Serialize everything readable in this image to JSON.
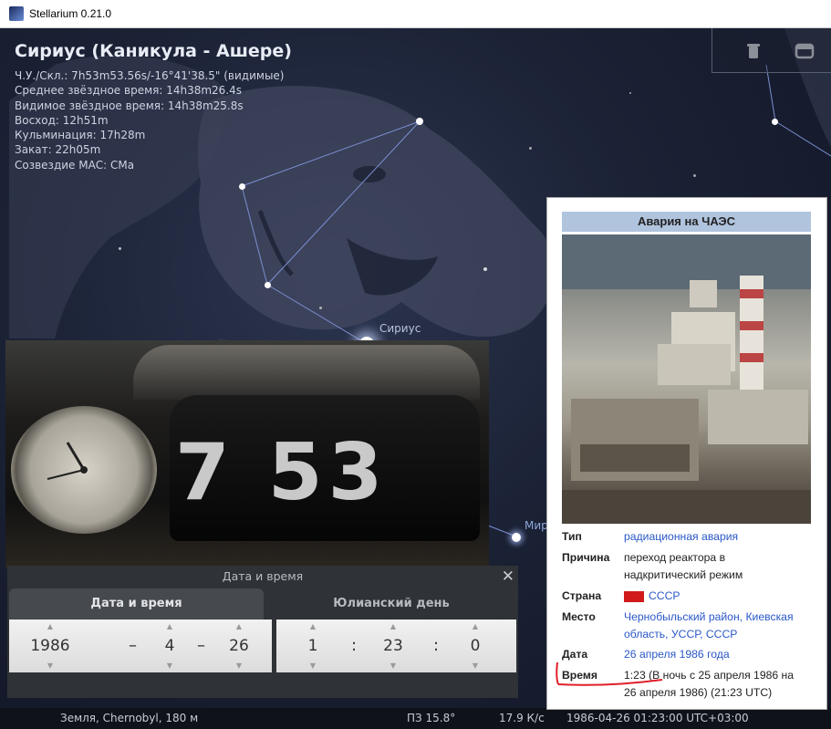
{
  "window": {
    "title": "Stellarium 0.21.0"
  },
  "object_info": {
    "name": "Сириус (Каникула - Ашере)",
    "lines": [
      "Ч.У./Скл.: 7h53m53.56s/-16°41'38.5\" (видимые)",
      "Среднее звёздное время: 14h38m26.4s",
      "Видимое звёздное время: 14h38m25.8s",
      "Восход: 12h51m",
      "Кульминация: 17h28m",
      "Закат: 22h05m",
      "Созвездие МАС: CMa"
    ]
  },
  "sky_labels": {
    "sirius": "Сириус",
    "mira": "Мир"
  },
  "top_icons": [
    "trash-icon",
    "window-icon"
  ],
  "clock_photo": {
    "digits": "7 53"
  },
  "datetime_panel": {
    "title": "Дата и время",
    "close": "✕",
    "tabs": [
      "Дата и время",
      "Юлианский день"
    ],
    "date": {
      "year": "1986",
      "month": "4",
      "day": "26",
      "sep": "–"
    },
    "time": {
      "hour": "1",
      "minute": "23",
      "second": "0",
      "sep": ":"
    },
    "arrow_up": "▲",
    "arrow_down": "▼"
  },
  "status": {
    "location": "Земля, Chernobyl, 180 м",
    "fov": "ПЗ 15.8°",
    "fps": "17.9 К/с",
    "datetime": "1986-04-26 01:23:00 UTC+03:00"
  },
  "wiki": {
    "title": "Авария на ЧАЭС",
    "rows": [
      {
        "key": "Тип",
        "value": "радиационная авария",
        "link": true
      },
      {
        "key": "Причина",
        "value": "переход реактора в надкритический режим",
        "link": false
      },
      {
        "key": "Страна",
        "value": "СССР",
        "link": true
      },
      {
        "key": "Место",
        "value": "Чернобыльский район, Киевская область, УССР, СССР",
        "link": true
      },
      {
        "key": "Дата",
        "value": "26 апреля 1986 года",
        "link": true
      },
      {
        "key": "Время",
        "value": "1:23 (В ночь с 25 апреля 1986 на 26 апреля 1986) (21:23 UTC)",
        "link": false
      }
    ]
  },
  "colors": {
    "sky": "#1b2235",
    "panel": "#2f3236",
    "wiki_header": "#b0c4de",
    "link": "#2a58c8",
    "annotation": "#e0202a"
  }
}
